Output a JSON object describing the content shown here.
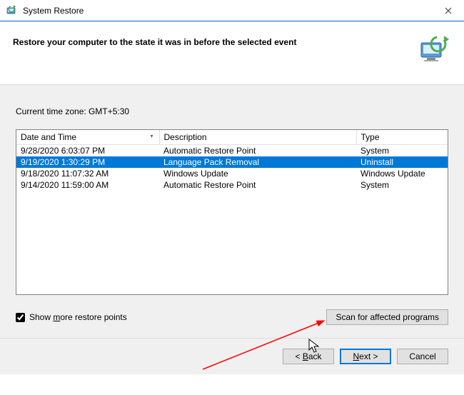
{
  "window": {
    "title": "System Restore"
  },
  "header": {
    "text": "Restore your computer to the state it was in before the selected event"
  },
  "timezone_label": "Current time zone: GMT+5:30",
  "columns": {
    "datetime": "Date and Time",
    "description": "Description",
    "type": "Type"
  },
  "rows": [
    {
      "datetime": "9/28/2020 6:03:07 PM",
      "description": "Automatic Restore Point",
      "type": "System",
      "selected": false
    },
    {
      "datetime": "9/19/2020 1:30:29 PM",
      "description": "Language Pack Removal",
      "type": "Uninstall",
      "selected": true
    },
    {
      "datetime": "9/18/2020 11:07:32 AM",
      "description": "Windows Update",
      "type": "Windows Update",
      "selected": false
    },
    {
      "datetime": "9/14/2020 11:59:00 AM",
      "description": "Automatic Restore Point",
      "type": "System",
      "selected": false
    }
  ],
  "show_more": {
    "label_pre": "Show ",
    "label_hot": "m",
    "label_post": "ore restore points",
    "checked": true
  },
  "scan_button": "Scan for affected programs",
  "buttons": {
    "back_pre": "< ",
    "back_hot": "B",
    "back_post": "ack",
    "next_hot": "N",
    "next_post": "ext >",
    "cancel": "Cancel"
  }
}
